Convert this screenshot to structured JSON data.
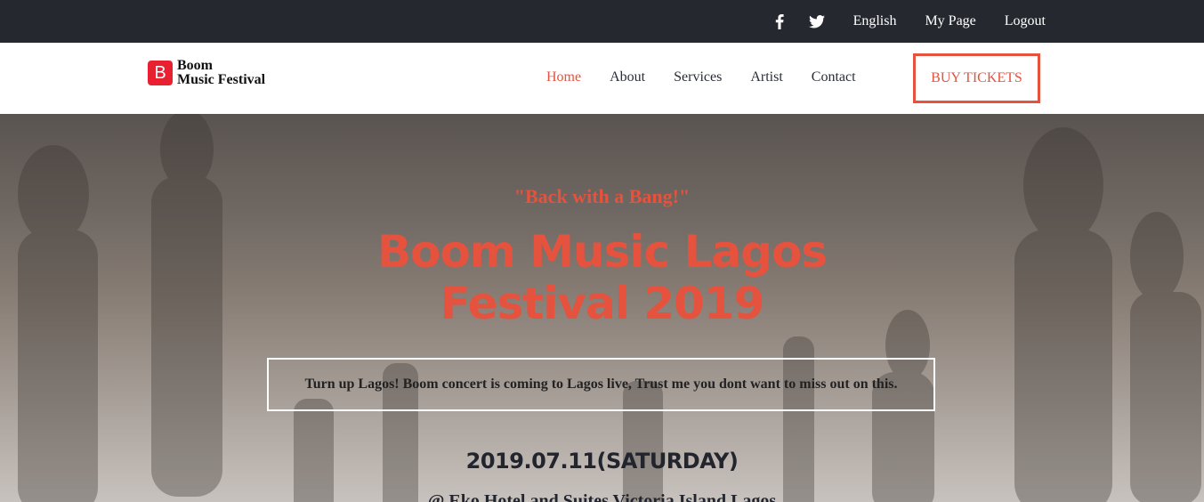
{
  "topbar": {
    "social": [
      {
        "name": "facebook-icon"
      },
      {
        "name": "twitter-icon"
      }
    ],
    "links": [
      "English",
      "My Page",
      "Logout"
    ]
  },
  "header": {
    "logo": {
      "mark": "B",
      "line1": "Boom",
      "line2": "Music Festival"
    },
    "nav": [
      "Home",
      "About",
      "Services",
      "Artist",
      "Contact"
    ],
    "active_nav": "Home",
    "buy_button": "BUY TICKETS"
  },
  "hero": {
    "tagline": "\"Back with a Bang!\"",
    "title_line1": "Boom Music Lagos",
    "title_line2": "Festival 2019",
    "intro": "Turn up Lagos! Boom concert is coming to Lagos live, Trust me you dont want to miss out on this.",
    "date": "2019.07.11(SATURDAY)",
    "venue": "@ Eko Hotel and Suites Victoria Island Lagos"
  },
  "colors": {
    "accent": "#e5523e",
    "logo_red": "#e8202f",
    "topbar_bg": "#262830"
  }
}
